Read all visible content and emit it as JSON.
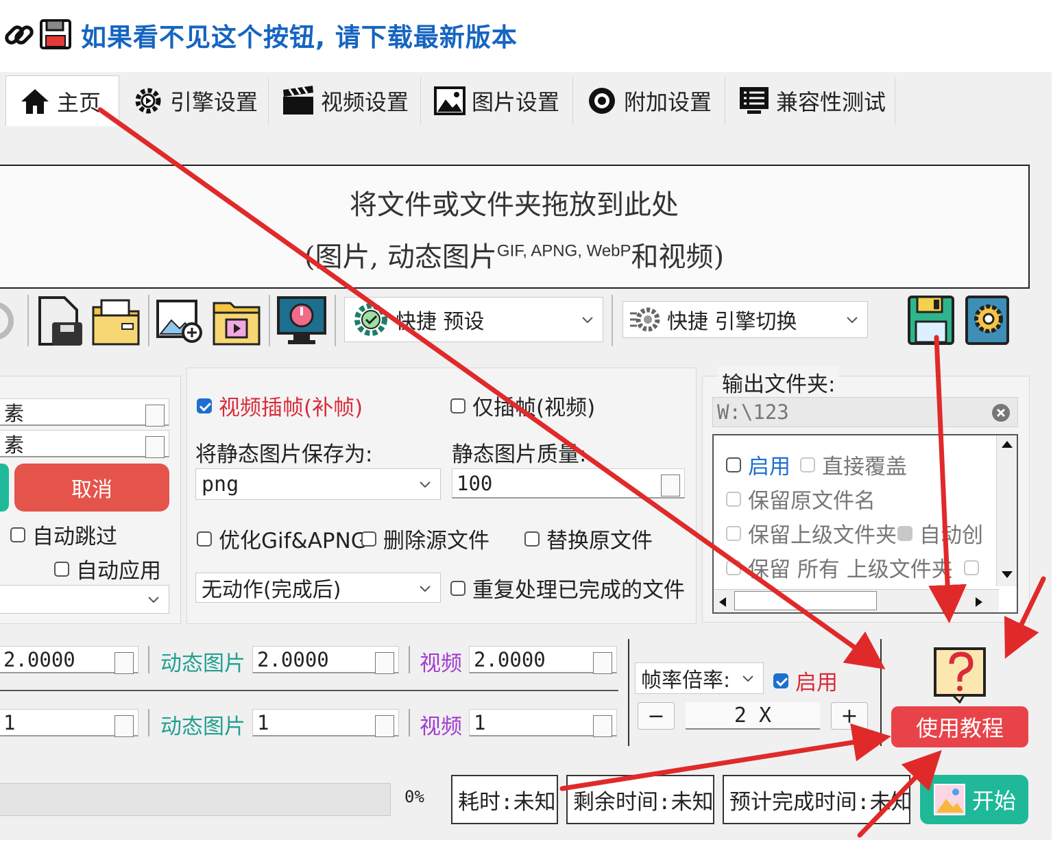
{
  "header": {
    "title": "如果看不见这个按钮, 请下载最新版本",
    "link_icon": "link-icon",
    "save_icon": "floppy-disk-icon"
  },
  "tabs": [
    {
      "label": "主页",
      "icon": "home-icon",
      "active": true
    },
    {
      "label": "引擎设置",
      "icon": "engine-gear-icon"
    },
    {
      "label": "视频设置",
      "icon": "clapperboard-icon"
    },
    {
      "label": "图片设置",
      "icon": "picture-icon"
    },
    {
      "label": "附加设置",
      "icon": "settings-badge-icon"
    },
    {
      "label": "兼容性测试",
      "icon": "monitor-list-icon"
    }
  ],
  "dropzone": {
    "line1": "将文件或文件夹拖放到此处",
    "line2_prefix": "(图片, 动态图片",
    "line2_sup": "GIF, APNG, WebP",
    "line2_suffix": "和视频)"
  },
  "toolbar": {
    "preset_combo": "快捷  预设",
    "engine_combo": "快捷  引擎切换"
  },
  "left_panel": {
    "row1": "素",
    "row2": "素",
    "cancel": "取消",
    "auto_skip": "自动跳过",
    "auto_apply": "自动应用"
  },
  "middle_panel": {
    "video_interp": "视频插帧(补帧)",
    "interp_only": "仅插帧(视频)",
    "save_static_as": "将静态图片保存为:",
    "static_quality": "静态图片质量:",
    "format_value": "png",
    "quality_value": "100",
    "optimize": "优化Gif&APNG",
    "delete_source": "删除源文件",
    "replace_original": "替换原文件",
    "after_action": "无动作(完成后)",
    "reprocess": "重复处理已完成的文件"
  },
  "output": {
    "title": "输出文件夹:",
    "path": "W:\\123",
    "enable": "启用",
    "overwrite": "直接覆盖",
    "keep_name": "保留原文件名",
    "keep_parent": "保留上级文件夹",
    "auto_create": "自动创",
    "keep_all_parent": "保留  所有  上级文件夹"
  },
  "scale": {
    "row1_v1": "2.0000",
    "anim_label": "动态图片",
    "row1_v2": "2.0000",
    "video_label": "视频",
    "row1_v3": "2.0000",
    "row2_v1": "1",
    "row2_v2": "1",
    "row2_v3": "1"
  },
  "framerate": {
    "label": "帧率倍率:",
    "enable": "启用",
    "minus": "−",
    "value": "2 X",
    "plus": "+"
  },
  "help": {
    "tutorial": "使用教程"
  },
  "status": {
    "progress_text": "0%",
    "progress": 0,
    "elapsed": "耗时:未知",
    "remaining": "剩余时间:未知",
    "eta": "预计完成时间:未知",
    "start": "开始"
  },
  "colors": {
    "accent_blue": "#1565c0",
    "cancel_red": "#e5544b",
    "tutorial_red": "#e9434a",
    "start_teal": "#1fb99a",
    "arrow_red": "#e02a2a"
  }
}
